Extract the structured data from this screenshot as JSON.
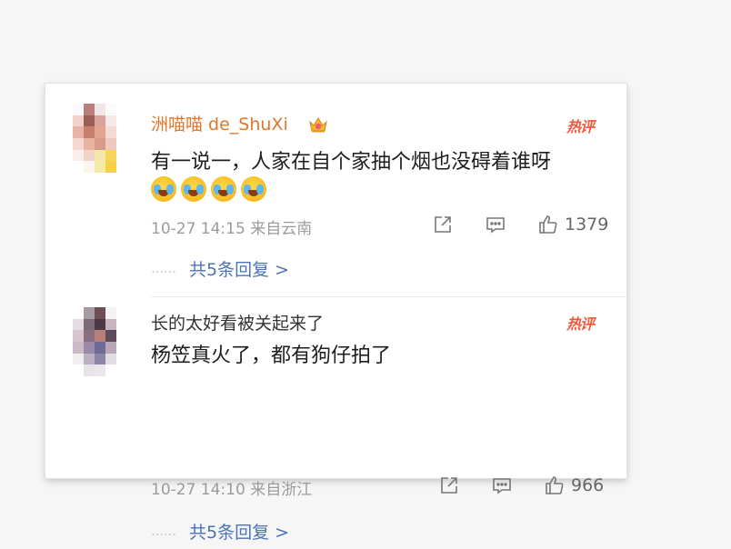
{
  "comments": [
    {
      "username": "洲喵喵 de_ShuXi",
      "vip_icon": "crown-badge-icon",
      "hot_badge": "热评",
      "text": "有一说一，人家在自个家抽个烟也没碍着谁呀",
      "emoji_icons": [
        "tears-of-joy-icon",
        "tears-of-joy-icon",
        "tears-of-joy-icon",
        "tears-of-joy-icon"
      ],
      "meta": "10-27 14:15  来自云南",
      "like_count": "1379",
      "dots": "……",
      "replies_label": "共5条回复 >"
    },
    {
      "username": "长的太好看被关起来了",
      "hot_badge": "热评",
      "text": "杨笠真火了，都有狗仔拍了",
      "meta": "10-27 14:10  来自浙江",
      "like_count": "966",
      "dots": "……",
      "replies_label": "共5条回复 >"
    }
  ],
  "colors": {
    "username_vip": "#e0772a",
    "hot_badge": "#f05a3c",
    "reply_link": "#4b73b7",
    "meta": "#9b9b9b"
  }
}
